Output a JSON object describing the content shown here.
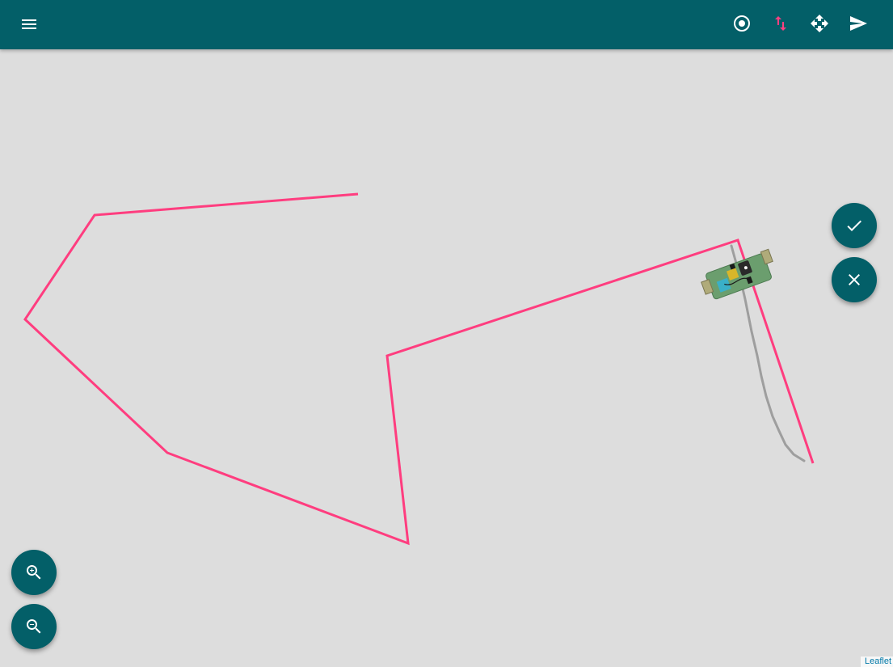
{
  "appbar": {
    "background": "#035f68",
    "menu_icon": "menu-icon",
    "actions": [
      {
        "name": "center-robot-button",
        "icon": "target-circle-icon",
        "color": "#ffffff"
      },
      {
        "name": "path-mode-button",
        "icon": "swap-vertical-icon",
        "color": "#ff4081"
      },
      {
        "name": "move-mode-button",
        "icon": "move-arrows-icon",
        "color": "#ffffff"
      },
      {
        "name": "send-button",
        "icon": "send-icon",
        "color": "#ffffff"
      }
    ]
  },
  "map": {
    "background": "#dddddd",
    "planned_path_color": "#ff3d7f",
    "trail_color": "#9e9e9e",
    "robot_icon": "robot-board-icon"
  },
  "fabs": {
    "confirm_icon": "check-icon",
    "cancel_icon": "close-icon",
    "zoom_in_icon": "zoom-in-icon",
    "zoom_out_icon": "zoom-out-icon",
    "color": "#035f68"
  },
  "attribution": {
    "text": "Leaflet"
  }
}
